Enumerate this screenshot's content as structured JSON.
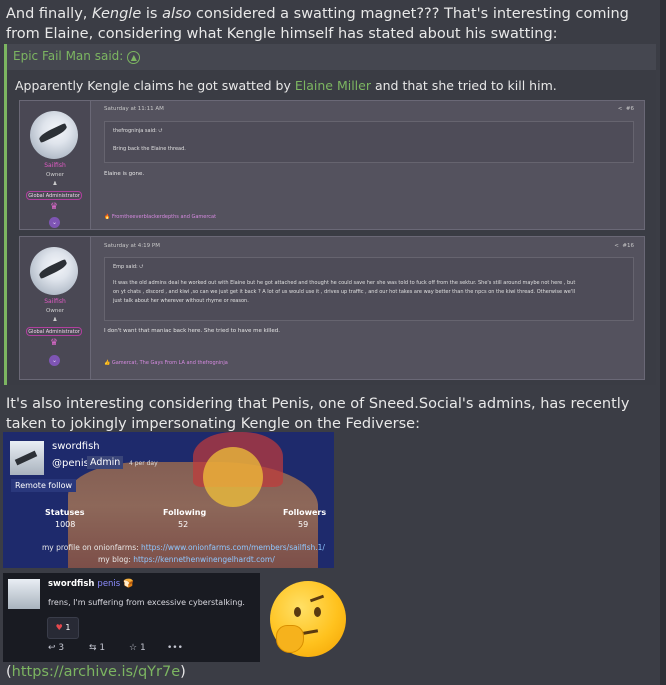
{
  "intro": {
    "t1": "And finally, ",
    "kengle": "Kengle",
    "t2": " is ",
    "also": "also",
    "t3": " considered a swatting magnet??? That's interesting coming from Elaine, considering what Kengle himself has stated about his swatting:"
  },
  "quote": {
    "author": "Epic Fail Man said:",
    "t1": "Apparently Kengle claims he got swatted by ",
    "name": "Elaine Miller",
    "t2": " and that she tried to kill him."
  },
  "post1": {
    "user": "Sailfish",
    "role": "Owner",
    "badge": "Global Administrator",
    "time": "Saturday at 11:11 AM",
    "num": "#6",
    "inner_author": "thefrogninja said:",
    "inner_text": "Bring back the Elaine thread.",
    "text": "Elaine is gone.",
    "reactions": "Fromtheeverblackerdepths and Gamercat"
  },
  "post2": {
    "user": "Sailfish",
    "role": "Owner",
    "badge": "Global Administrator",
    "time": "Saturday at 4:19 PM",
    "num": "#16",
    "inner_author": "Emp said:",
    "inner_text1": "It was the old admins deal he worked out with Elaine but he got attached and thought he could save her she was told to fuck off from the sektur. She's still around maybe not here , but",
    "inner_text2": "on yt chats , discord , and kiwi ,so can we just get it back ? A lot of us would use it , drives up traffic , and our hot takes are way better than the npcs on the kiwi thread. Otherwise we'll",
    "inner_text3": "just talk about her wherever without rhyme or reason.",
    "text": "I don't want that maniac back here. She tried to have me killed.",
    "reactions": "Gamercat, The Gays From LA and thefrogninja"
  },
  "para2": "It's also interesting considering that Penis, one of Sneed.Social's admins, has recently taken to jokingly impersonating Kengle on the Fediverse:",
  "profile": {
    "name": "swordfish",
    "handle": "@penis",
    "admin": "Admin",
    "day": "4 per day",
    "remote": "Remote follow",
    "statuses_label": "Statuses",
    "statuses": "1008",
    "following_label": "Following",
    "following": "52",
    "followers_label": "Followers",
    "followers": "59",
    "link1_label": "my profile on onionfarms: ",
    "link1": "https://www.onionfarms.com/members/sailfish.1/",
    "link2_label": "my blog: ",
    "link2": "https://kennethenwinengelhardt.com/"
  },
  "toot": {
    "name": "swordfish",
    "handle": "penis",
    "text": "frens, I'm suffering from excessive cyberstalking.",
    "likes": "1",
    "replies": "3",
    "boosts": "1",
    "favs": "1",
    "more": "•••"
  },
  "archive": {
    "open": "(",
    "link": "https://archive.is/qYr7e",
    "close": ")"
  }
}
